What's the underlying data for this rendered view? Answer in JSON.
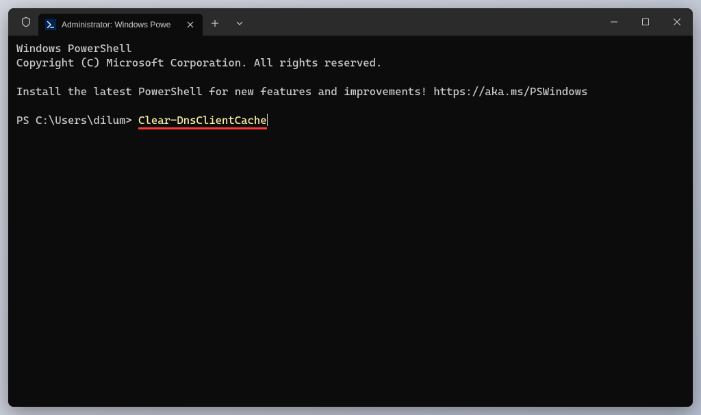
{
  "titlebar": {
    "tab_title": "Administrator: Windows Powe",
    "icons": {
      "shield": "shield-icon",
      "powershell": "powershell-icon",
      "close_tab": "close-icon",
      "new_tab": "plus-icon",
      "dropdown": "chevron-down-icon",
      "minimize": "minimize-icon",
      "maximize": "maximize-icon",
      "close_window": "close-icon"
    }
  },
  "terminal": {
    "line1": "Windows PowerShell",
    "line2": "Copyright (C) Microsoft Corporation. All rights reserved.",
    "line3": "Install the latest PowerShell for new features and improvements! https://aka.ms/PSWindows",
    "prompt": "PS C:\\Users\\dilum> ",
    "command": "Clear-DnsClientCache"
  },
  "colors": {
    "command": "#f9f1a5",
    "underline": "#ff3b30",
    "bg": "#0c0c0c",
    "fg": "#cccccc"
  }
}
